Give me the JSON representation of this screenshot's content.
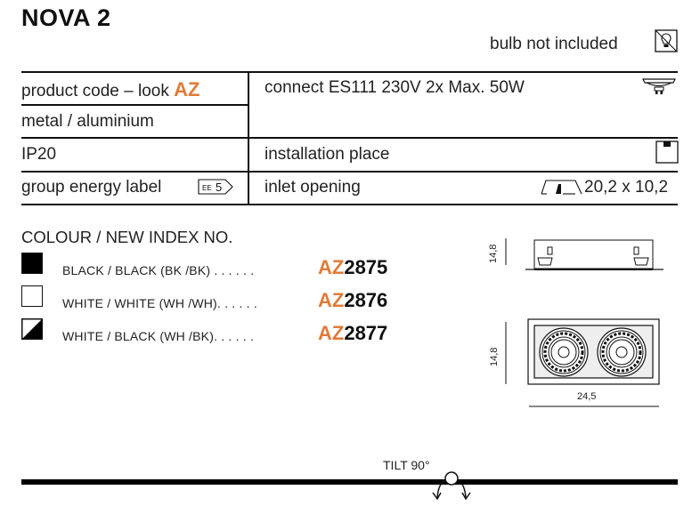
{
  "header": {
    "title": "NOVA 2",
    "bulb_note": "bulb not included",
    "bulb_icon": "bulb-crossed-icon"
  },
  "spec_table": {
    "left": [
      {
        "label": "product code – look ",
        "highlight": "AZ"
      },
      {
        "label": "metal / aluminium"
      },
      {
        "label": "IP20"
      },
      {
        "label": "group energy label",
        "badge": "EE 5"
      }
    ],
    "right": [
      {
        "label": "connect ES111 230V 2x Max. 50W",
        "icon": "es111-bulb-icon"
      },
      {
        "label": "installation place",
        "icon": "ceiling-mount-icon"
      },
      {
        "label": "inlet opening",
        "icon": "recessed-opening-icon",
        "value": "20,2 x 10,2"
      }
    ]
  },
  "colours": {
    "title": "COLOUR / NEW INDEX NO.",
    "items": [
      {
        "swatch": "black",
        "label": "BLACK / BLACK (BK /BK) . . . . . .",
        "prefix": "AZ",
        "number": "2875"
      },
      {
        "swatch": "white",
        "label": "WHITE / WHITE (WH /WH). . . . . .",
        "prefix": "AZ",
        "number": "2876"
      },
      {
        "swatch": "white-black",
        "label": "WHITE / BLACK (WH /BK). . . . . .",
        "prefix": "AZ",
        "number": "2877"
      }
    ]
  },
  "drawings": {
    "side_height": "14,8",
    "front_height": "14,8",
    "front_width": "24,5"
  },
  "tilt": {
    "label": "TILT 90°"
  },
  "colors": {
    "accent": "#e07b39",
    "text": "#222222",
    "line": "#111111"
  }
}
